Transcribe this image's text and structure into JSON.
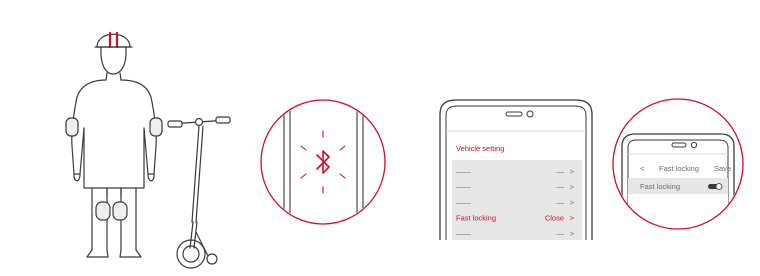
{
  "colors": {
    "accent": "#c8102e",
    "line": "#3a3a3a",
    "panel": "#e6e6e6"
  },
  "icons": [
    "bluetooth-icon",
    "chevron-right-icon",
    "chevron-left-icon",
    "toggle-switch"
  ],
  "phone_main": {
    "section_title": "Vehicle setting",
    "rows": [
      {
        "label": "——",
        "value": "—",
        "arrow": ">"
      },
      {
        "label": "——",
        "value": "—",
        "arrow": ">"
      },
      {
        "label": "——",
        "value": "—",
        "arrow": ">"
      },
      {
        "label": "Fast locking",
        "value": "Close",
        "arrow": ">"
      },
      {
        "label": "——",
        "value": "—",
        "arrow": ">"
      }
    ]
  },
  "phone_zoom": {
    "back": "<",
    "title": "Fast locking",
    "save": "Save",
    "setting_label": "Fast locking",
    "toggle_on": true
  }
}
